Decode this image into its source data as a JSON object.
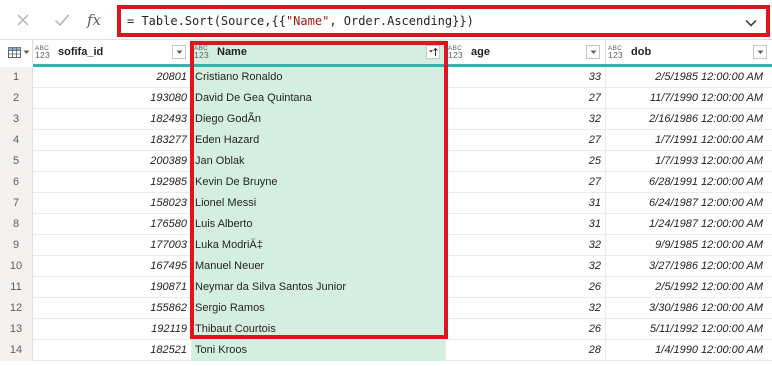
{
  "formula_bar": {
    "cancel_icon": "close-icon",
    "commit_icon": "checkmark-icon",
    "fx_label": "fx",
    "formula_prefix": "= Table.Sort(Source,{{",
    "formula_string": "\"Name\"",
    "formula_suffix": ", Order.Ascending}})"
  },
  "columns": [
    {
      "label": "sofifa_id",
      "type_top": "ABC",
      "type_bottom": "123"
    },
    {
      "label": "Name",
      "type_top": "ABC",
      "type_bottom": "123",
      "sorted": "ascending"
    },
    {
      "label": "age",
      "type_top": "ABC",
      "type_bottom": "123"
    },
    {
      "label": "dob",
      "type_top": "ABC",
      "type_bottom": "123"
    }
  ],
  "rows": [
    {
      "n": "1",
      "id": "20801",
      "name": "Cristiano Ronaldo",
      "age": "33",
      "dob": "2/5/1985 12:00:00 AM"
    },
    {
      "n": "2",
      "id": "193080",
      "name": "David De Gea Quintana",
      "age": "27",
      "dob": "11/7/1990 12:00:00 AM"
    },
    {
      "n": "3",
      "id": "182493",
      "name": "Diego GodÃn",
      "age": "32",
      "dob": "2/16/1986 12:00:00 AM"
    },
    {
      "n": "4",
      "id": "183277",
      "name": "Eden Hazard",
      "age": "27",
      "dob": "1/7/1991 12:00:00 AM"
    },
    {
      "n": "5",
      "id": "200389",
      "name": "Jan Oblak",
      "age": "25",
      "dob": "1/7/1993 12:00:00 AM"
    },
    {
      "n": "6",
      "id": "192985",
      "name": "Kevin De Bruyne",
      "age": "27",
      "dob": "6/28/1991 12:00:00 AM"
    },
    {
      "n": "7",
      "id": "158023",
      "name": "Lionel Messi",
      "age": "31",
      "dob": "6/24/1987 12:00:00 AM"
    },
    {
      "n": "8",
      "id": "176580",
      "name": "Luis Alberto",
      "age": "31",
      "dob": "1/24/1987 12:00:00 AM"
    },
    {
      "n": "9",
      "id": "177003",
      "name": "Luka ModriÄ‡",
      "age": "32",
      "dob": "9/9/1985 12:00:00 AM"
    },
    {
      "n": "10",
      "id": "167495",
      "name": "Manuel Neuer",
      "age": "32",
      "dob": "3/27/1986 12:00:00 AM"
    },
    {
      "n": "11",
      "id": "190871",
      "name": "Neymar da Silva Santos Junior",
      "age": "26",
      "dob": "2/5/1992 12:00:00 AM"
    },
    {
      "n": "12",
      "id": "155862",
      "name": "Sergio Ramos",
      "age": "32",
      "dob": "3/30/1986 12:00:00 AM"
    },
    {
      "n": "13",
      "id": "192119",
      "name": "Thibaut Courtois",
      "age": "26",
      "dob": "5/11/1992 12:00:00 AM"
    },
    {
      "n": "14",
      "id": "182521",
      "name": "Toni Kroos",
      "age": "28",
      "dob": "1/4/1990 12:00:00 AM"
    }
  ],
  "colors": {
    "highlight_border": "#e0141e",
    "sorted_column_fill": "#d4efe1",
    "header_accent": "#31b6a8"
  }
}
